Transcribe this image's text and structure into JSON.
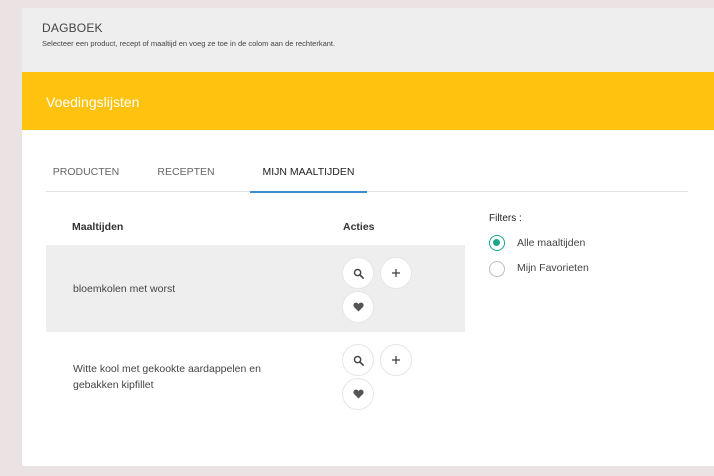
{
  "header": {
    "title": "DAGBOEK",
    "subtitle": "Selecteer een product, recept of maaltijd en voeg ze toe in de colom aan de rechterkant."
  },
  "card": {
    "title": "Voedingslijsten"
  },
  "tabs": [
    {
      "label": "PRODUCTEN",
      "active": false
    },
    {
      "label": "RECEPTEN",
      "active": false
    },
    {
      "label": "MIJN MAALTIJDEN",
      "active": true
    }
  ],
  "table": {
    "col_meals": "Maaltijden",
    "col_actions": "Acties",
    "rows": [
      {
        "label_line1": "bloemkolen met worst",
        "label_line2": ""
      },
      {
        "label_line1": "Witte kool met gekookte aardappelen en",
        "label_line2": "gebakken kipfillet"
      }
    ]
  },
  "filters": {
    "title": "Filters :",
    "options": [
      {
        "label": "Alle maaltijden",
        "checked": true
      },
      {
        "label": "Mijn Favorieten",
        "checked": false
      }
    ]
  },
  "colors": {
    "accent": "#ffc20e",
    "tab_underline": "#3a8fd0",
    "radio_checked": "#1aa88c"
  },
  "icons": {
    "search": "search-icon",
    "add": "plus-icon",
    "favorite": "heart-icon"
  }
}
